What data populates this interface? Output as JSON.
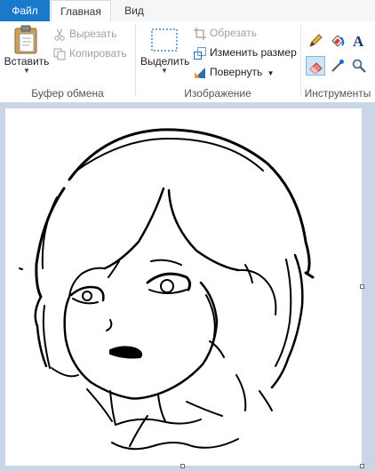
{
  "tabs": {
    "file": "Файл",
    "home": "Главная",
    "view": "Вид"
  },
  "clipboard": {
    "paste_label": "Вставить",
    "cut_label": "Вырезать",
    "copy_label": "Копировать",
    "group_label": "Буфер обмена"
  },
  "image": {
    "select_label": "Выделить",
    "crop_label": "Обрезать",
    "resize_label": "Изменить размер",
    "rotate_label": "Повернуть",
    "group_label": "Изображение"
  },
  "tools": {
    "group_label": "Инструменты",
    "items": [
      "pencil-icon",
      "fill-icon",
      "text-icon",
      "eraser-icon",
      "color-picker-icon",
      "magnifier-icon"
    ],
    "active": "eraser-icon"
  },
  "colors": {
    "file_tab": "#1979ca",
    "workspace": "#c9d6e8",
    "canvas": "#ffffff",
    "active_tool": "#cde6f7"
  }
}
